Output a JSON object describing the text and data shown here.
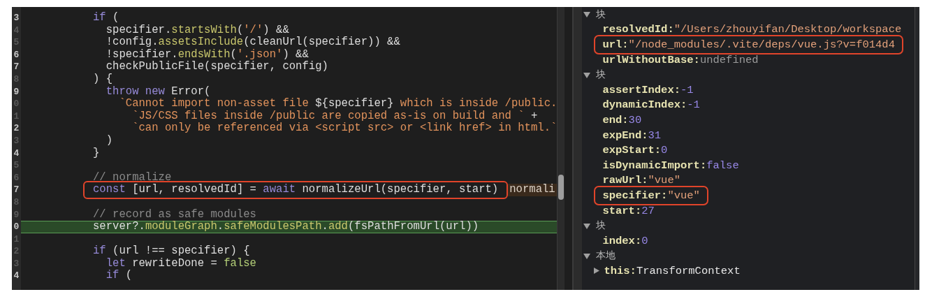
{
  "editor": {
    "lines": [
      {
        "number": "3",
        "bright": true,
        "current": false,
        "framed": false,
        "tokens": [
          {
            "kind": "keyword",
            "text": "if"
          },
          {
            "kind": "plain",
            "text": " ("
          }
        ]
      },
      {
        "number": "4",
        "bright": false,
        "current": false,
        "framed": false,
        "tokens": [
          {
            "kind": "plain",
            "text": "  specifier."
          },
          {
            "kind": "method",
            "text": "startsWith"
          },
          {
            "kind": "plain",
            "text": "("
          },
          {
            "kind": "string",
            "text": "'/'"
          },
          {
            "kind": "plain",
            "text": ") &&"
          }
        ]
      },
      {
        "number": "5",
        "bright": false,
        "current": false,
        "framed": false,
        "tokens": [
          {
            "kind": "plain",
            "text": "  !config."
          },
          {
            "kind": "method",
            "text": "assetsInclude"
          },
          {
            "kind": "plain",
            "text": "(cleanUrl(specifier)) &&"
          }
        ]
      },
      {
        "number": "6",
        "bright": true,
        "current": false,
        "framed": false,
        "tokens": [
          {
            "kind": "plain",
            "text": "  !specifier."
          },
          {
            "kind": "method",
            "text": "endsWith"
          },
          {
            "kind": "plain",
            "text": "("
          },
          {
            "kind": "string",
            "text": "'.json'"
          },
          {
            "kind": "plain",
            "text": ") &&"
          }
        ]
      },
      {
        "number": "7",
        "bright": true,
        "current": false,
        "framed": false,
        "tokens": [
          {
            "kind": "plain",
            "text": "  checkPublicFile(specifier, config)"
          }
        ]
      },
      {
        "number": "8",
        "bright": false,
        "current": false,
        "framed": false,
        "tokens": [
          {
            "kind": "plain",
            "text": ") {"
          }
        ]
      },
      {
        "number": "9",
        "bright": true,
        "current": false,
        "framed": false,
        "tokens": [
          {
            "kind": "keyword",
            "text": "  throw new"
          },
          {
            "kind": "plain",
            "text": " Error("
          }
        ]
      },
      {
        "number": "0",
        "bright": false,
        "current": false,
        "framed": false,
        "tokens": [
          {
            "kind": "string",
            "text": "    `Cannot import non-asset file "
          },
          {
            "kind": "plain",
            "text": "${specifier}"
          },
          {
            "kind": "string",
            "text": " which is inside /public."
          }
        ]
      },
      {
        "number": "1",
        "bright": false,
        "current": false,
        "framed": false,
        "tokens": [
          {
            "kind": "string",
            "text": "      `JS/CSS files inside /public are copied as-is on build and `"
          },
          {
            "kind": "plain",
            "text": " +"
          }
        ]
      },
      {
        "number": "2",
        "bright": true,
        "current": false,
        "framed": false,
        "tokens": [
          {
            "kind": "string",
            "text": "      `can only be referenced via <script src> or <link href> in html.`"
          }
        ]
      },
      {
        "number": "3",
        "bright": false,
        "current": false,
        "framed": false,
        "tokens": [
          {
            "kind": "plain",
            "text": "  )"
          }
        ]
      },
      {
        "number": "4",
        "bright": true,
        "current": false,
        "framed": false,
        "tokens": [
          {
            "kind": "plain",
            "text": "}"
          }
        ]
      },
      {
        "number": "5",
        "bright": false,
        "current": false
      },
      {
        "number": "6",
        "bright": false,
        "current": false,
        "framed": false,
        "tokens": [
          {
            "kind": "comment",
            "text": "// normalize"
          }
        ]
      },
      {
        "number": "7",
        "bright": true,
        "current": false,
        "framed": true,
        "tokens": [
          {
            "kind": "keyword",
            "text": "const"
          },
          {
            "kind": "plain",
            "text": " [url, resolvedId] = "
          },
          {
            "kind": "keyword",
            "text": "await"
          },
          {
            "kind": "plain",
            "text": " normalizeUrl(specifier, start)"
          }
        ],
        "hint": "normali"
      },
      {
        "number": "8",
        "bright": false,
        "current": false
      },
      {
        "number": "9",
        "bright": false,
        "current": false,
        "framed": false,
        "tokens": [
          {
            "kind": "comment",
            "text": "// record as safe modules"
          }
        ]
      },
      {
        "number": "0",
        "bright": true,
        "current": true,
        "framed": false,
        "tokens": [
          {
            "kind": "plain",
            "text": "server?."
          },
          {
            "kind": "method",
            "text": "moduleGraph"
          },
          {
            "kind": "plain",
            "text": "."
          },
          {
            "kind": "method",
            "text": "safeModulesPath"
          },
          {
            "kind": "plain",
            "text": "."
          },
          {
            "kind": "method",
            "text": "add"
          },
          {
            "kind": "plain",
            "text": "(fsPathFromUrl(url))"
          }
        ]
      },
      {
        "number": "1",
        "bright": false,
        "current": false
      },
      {
        "number": "2",
        "bright": false,
        "current": false,
        "framed": false,
        "tokens": [
          {
            "kind": "keyword",
            "text": "if"
          },
          {
            "kind": "plain",
            "text": " (url !== specifier) {"
          }
        ]
      },
      {
        "number": "3",
        "bright": false,
        "current": false,
        "framed": false,
        "tokens": [
          {
            "kind": "keyword",
            "text": "  let"
          },
          {
            "kind": "plain",
            "text": " rewriteDone = "
          },
          {
            "kind": "literal",
            "text": "false"
          }
        ]
      },
      {
        "number": "4",
        "bright": true,
        "current": false,
        "framed": false,
        "tokens": [
          {
            "kind": "keyword",
            "text": "  if"
          },
          {
            "kind": "plain",
            "text": " ("
          }
        ]
      }
    ]
  },
  "scopes": [
    {
      "label": "块",
      "expanded": true,
      "children": [
        {
          "key": "resolvedId:",
          "value": "\"/Users/zhouyifan/Desktop/workspace",
          "kind": "string",
          "framed": false
        },
        {
          "key": "url:",
          "value": "\"/node_modules/.vite/deps/vue.js?v=f014d4",
          "kind": "string",
          "framed": true
        },
        {
          "key": "urlWithoutBase:",
          "value": "undefined",
          "kind": "undefined",
          "framed": false
        }
      ]
    },
    {
      "label": "块",
      "expanded": true,
      "children": [
        {
          "key": "assertIndex:",
          "value": "-1",
          "kind": "number",
          "framed": false
        },
        {
          "key": "dynamicIndex:",
          "value": "-1",
          "kind": "number",
          "framed": false
        },
        {
          "key": "end:",
          "value": "30",
          "kind": "number",
          "framed": false
        },
        {
          "key": "expEnd:",
          "value": "31",
          "kind": "number",
          "framed": false
        },
        {
          "key": "expStart:",
          "value": "0",
          "kind": "number",
          "framed": false
        },
        {
          "key": "isDynamicImport:",
          "value": "false",
          "kind": "boolean",
          "framed": false
        },
        {
          "key": "rawUrl:",
          "value": "\"vue\"",
          "kind": "string",
          "framed": false
        },
        {
          "key": "specifier:",
          "value": "\"vue\"",
          "kind": "string",
          "framed": true
        },
        {
          "key": "start:",
          "value": "27",
          "kind": "number",
          "framed": false
        }
      ]
    },
    {
      "label": "块",
      "expanded": true,
      "children": [
        {
          "key": "index:",
          "value": "0",
          "kind": "number",
          "framed": false
        }
      ]
    },
    {
      "label": "本地",
      "expanded": true,
      "children": [
        {
          "key": "this:",
          "value": "TransformContext",
          "kind": "object",
          "expanded": false,
          "framed": false
        }
      ]
    }
  ]
}
